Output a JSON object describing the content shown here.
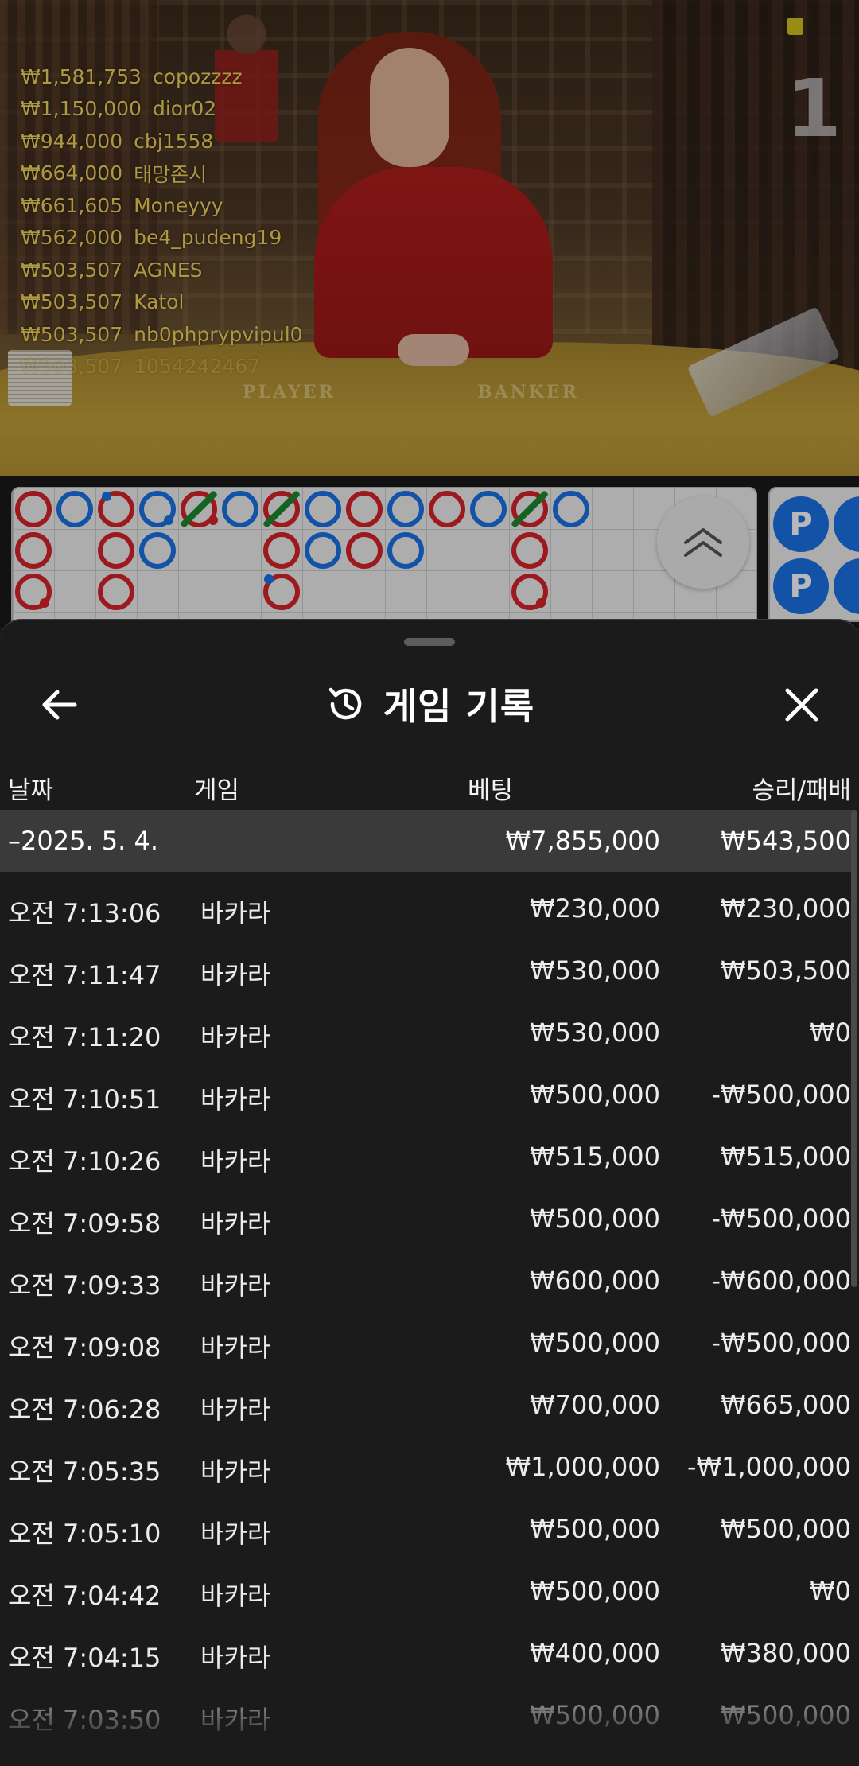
{
  "video": {
    "round_number": "1",
    "table_labels": {
      "player": "PLAYER",
      "banker": "BANKER"
    },
    "recent_winners": [
      {
        "amount": "₩1,581,753",
        "user": "copozzzz"
      },
      {
        "amount": "₩1,150,000",
        "user": "dior02"
      },
      {
        "amount": "₩944,000",
        "user": "cbj1558"
      },
      {
        "amount": "₩664,000",
        "user": "태망존시"
      },
      {
        "amount": "₩661,605",
        "user": "Moneyyy"
      },
      {
        "amount": "₩562,000",
        "user": "be4_pudeng19"
      },
      {
        "amount": "₩503,507",
        "user": "AGNES"
      },
      {
        "amount": "₩503,507",
        "user": "Katol"
      },
      {
        "amount": "₩503,507",
        "user": "nb0phprypvipul0"
      },
      {
        "amount": "₩503,507",
        "user": "1054242467"
      }
    ]
  },
  "roadmap": {
    "bead_label": "P",
    "colors": {
      "banker": "#d8232a",
      "player": "#1b73e8",
      "tie": "#1e8a2e"
    }
  },
  "sheet": {
    "title": "게임 기록",
    "icons": {
      "back": "arrow-left-icon",
      "history": "history-icon",
      "close": "close-icon"
    },
    "columns": {
      "date": "날짜",
      "game": "게임",
      "bet": "베팅",
      "result": "승리/패배"
    },
    "day_summary": {
      "date": "–2025. 5. 4.",
      "bet": "₩7,855,000",
      "result": "₩543,500"
    },
    "rows": [
      {
        "time": "오전 7:13:06",
        "game": "바카라",
        "bet": "₩230,000",
        "result": "₩230,000"
      },
      {
        "time": "오전 7:11:47",
        "game": "바카라",
        "bet": "₩530,000",
        "result": "₩503,500"
      },
      {
        "time": "오전 7:11:20",
        "game": "바카라",
        "bet": "₩530,000",
        "result": "₩0"
      },
      {
        "time": "오전 7:10:51",
        "game": "바카라",
        "bet": "₩500,000",
        "result": "-₩500,000"
      },
      {
        "time": "오전 7:10:26",
        "game": "바카라",
        "bet": "₩515,000",
        "result": "₩515,000"
      },
      {
        "time": "오전 7:09:58",
        "game": "바카라",
        "bet": "₩500,000",
        "result": "-₩500,000"
      },
      {
        "time": "오전 7:09:33",
        "game": "바카라",
        "bet": "₩600,000",
        "result": "-₩600,000"
      },
      {
        "time": "오전 7:09:08",
        "game": "바카라",
        "bet": "₩500,000",
        "result": "-₩500,000"
      },
      {
        "time": "오전 7:06:28",
        "game": "바카라",
        "bet": "₩700,000",
        "result": "₩665,000"
      },
      {
        "time": "오전 7:05:35",
        "game": "바카라",
        "bet": "₩1,000,000",
        "result": "-₩1,000,000"
      },
      {
        "time": "오전 7:05:10",
        "game": "바카라",
        "bet": "₩500,000",
        "result": "₩500,000"
      },
      {
        "time": "오전 7:04:42",
        "game": "바카라",
        "bet": "₩500,000",
        "result": "₩0"
      },
      {
        "time": "오전 7:04:15",
        "game": "바카라",
        "bet": "₩400,000",
        "result": "₩380,000"
      },
      {
        "time": "오전 7:03:50",
        "game": "바카라",
        "bet": "₩500,000",
        "result": "₩500,000"
      }
    ]
  }
}
